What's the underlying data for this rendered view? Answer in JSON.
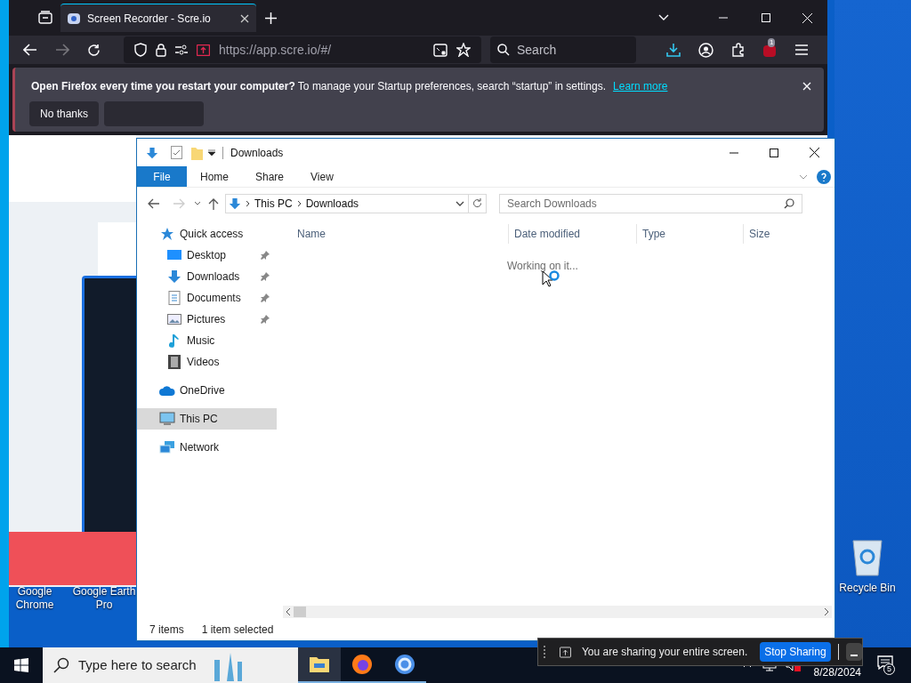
{
  "browser": {
    "tab": {
      "title": "Screen Recorder - Scre.io",
      "selected": true
    },
    "address": "https://app.scre.io/#/",
    "search": {
      "placeholder": "Search"
    },
    "extension_badge": "1",
    "notification": {
      "message": "**Open Firefox every time you restart your computer?** To manage your Startup preferences, search “startup” in settings.",
      "link": "Learn more",
      "buttons": [
        "No thanks"
      ]
    }
  },
  "explorer": {
    "title": "Downloads",
    "ribbon_tabs": [
      {
        "label": "File",
        "selected": true
      },
      {
        "label": "Home",
        "selected": false
      },
      {
        "label": "Share",
        "selected": false
      },
      {
        "label": "View",
        "selected": false
      }
    ],
    "breadcrumb": [
      "This PC",
      "Downloads"
    ],
    "search": {
      "placeholder": "Search Downloads"
    },
    "columns": [
      "Name",
      "Date modified",
      "Type",
      "Size"
    ],
    "loading_text": "Working on it...",
    "sidebar": {
      "items": [
        {
          "label": "Quick access",
          "kind": "star",
          "selected": false,
          "children": [
            {
              "label": "Desktop",
              "kind": "desktop",
              "pinned": true,
              "selected": false
            },
            {
              "label": "Downloads",
              "kind": "download",
              "pinned": true,
              "selected": false
            },
            {
              "label": "Documents",
              "kind": "document",
              "pinned": true,
              "selected": false
            },
            {
              "label": "Pictures",
              "kind": "pictures",
              "pinned": true,
              "selected": false
            },
            {
              "label": "Music",
              "kind": "music",
              "pinned": false,
              "selected": false
            },
            {
              "label": "Videos",
              "kind": "videos",
              "pinned": false,
              "selected": false
            }
          ]
        },
        {
          "label": "OneDrive",
          "kind": "cloud",
          "selected": false
        },
        {
          "label": "This PC",
          "kind": "pc",
          "selected": true
        },
        {
          "label": "Network",
          "kind": "network",
          "selected": false
        }
      ]
    },
    "status_bar": [
      "7 items",
      "1 item selected"
    ]
  },
  "desktop_icons": [
    {
      "label": "Google\nChrome"
    },
    {
      "label": "Google Earth\nPro"
    },
    {
      "label": "Recycle Bin"
    }
  ],
  "sharing_bar": {
    "message": "You are sharing your entire screen.",
    "button": "Stop Sharing"
  },
  "taskbar": {
    "search": {
      "placeholder": "Type here to search"
    },
    "date": "8/28/2024",
    "notification_count": "5"
  }
}
